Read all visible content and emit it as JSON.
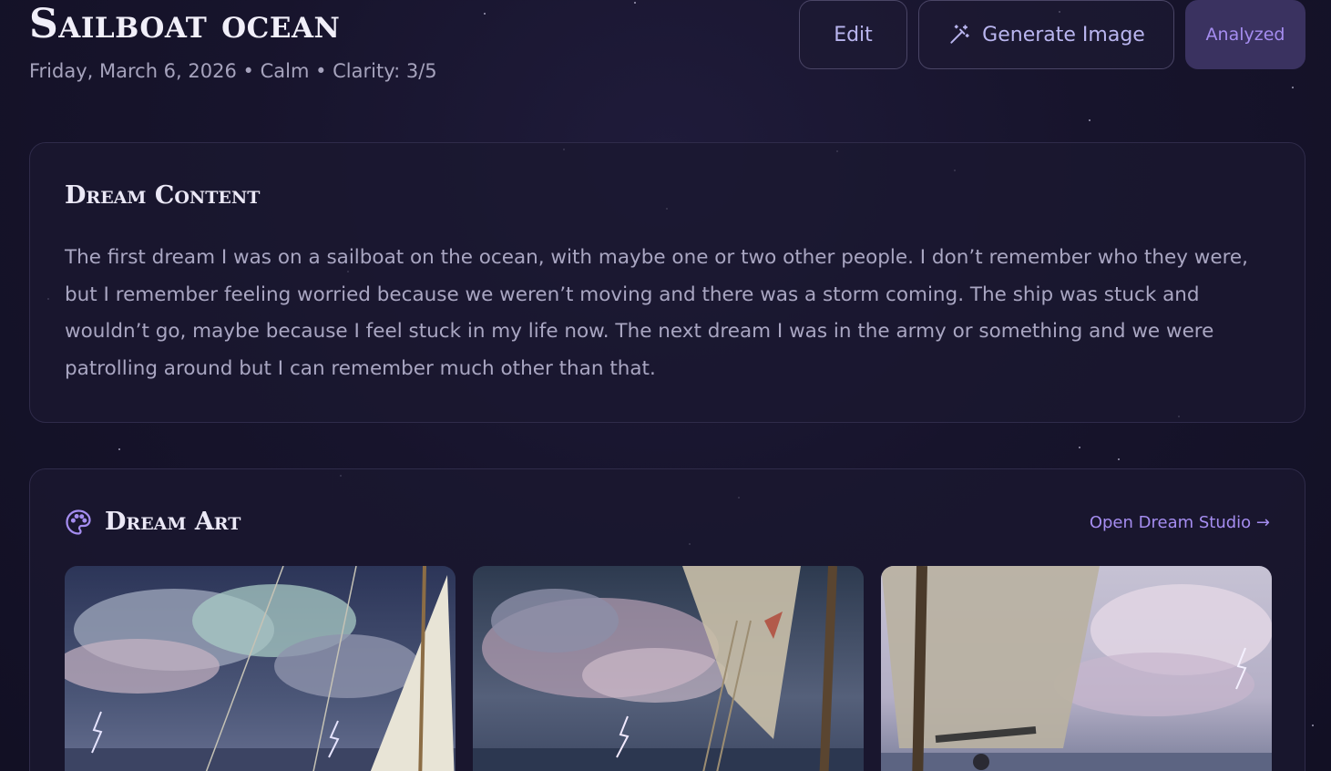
{
  "dream": {
    "title": "Sailboat ocean",
    "meta": "Friday, March 6, 2026 • Calm • Clarity: 3/5"
  },
  "actions": {
    "edit_label": "Edit",
    "generate_label": "Generate Image",
    "generate_icon": "magic-wand-icon",
    "status_label": "Analyzed"
  },
  "content": {
    "heading": "Dream Content",
    "text": "The first dream I was on a sailboat on the ocean, with maybe one or two other people. I don’t remember who they were, but I remember feeling worried because we weren’t moving and there was a storm coming. The ship was stuck and wouldn’t go, maybe because I feel stuck in my life now. The next dream I was in the army or something and we were patrolling around but I can remember much other than that."
  },
  "art": {
    "heading": "Dream Art",
    "icon": "palette-icon",
    "studio_link": "Open Dream Studio →",
    "images": [
      {
        "name": "stormy-sail-art-1"
      },
      {
        "name": "stormy-sail-art-2"
      },
      {
        "name": "stormy-sail-art-3"
      }
    ]
  },
  "colors": {
    "accent": "#a58df0",
    "background": "#17142c",
    "card": "#1b1830"
  }
}
